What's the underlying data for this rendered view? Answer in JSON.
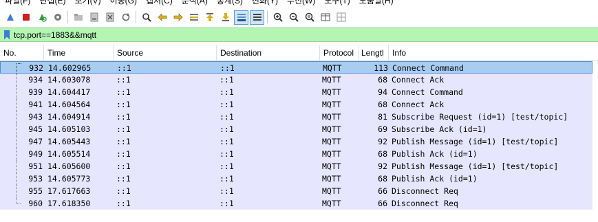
{
  "menu": [
    "파일(F)",
    "편집(E)",
    "보기(V)",
    "이동(G)",
    "캡처(C)",
    "분석(A)",
    "통계(S)",
    "전화(Y)",
    "무선(W)",
    "도구(T)",
    "도움말(H)"
  ],
  "toolbar": {
    "buttons": [
      {
        "icon": "shark-fin-start-icon"
      },
      {
        "icon": "stop-capture-icon"
      },
      {
        "icon": "restart-capture-icon"
      },
      {
        "icon": "capture-options-gear-icon"
      },
      {
        "icon": "open-file-icon"
      },
      {
        "icon": "save-file-icon"
      },
      {
        "icon": "close-file-icon"
      },
      {
        "icon": "reload-icon"
      },
      {
        "icon": "find-packet-icon"
      },
      {
        "icon": "go-back-icon"
      },
      {
        "icon": "go-forward-icon"
      },
      {
        "icon": "go-to-packet-icon"
      },
      {
        "icon": "go-first-icon"
      },
      {
        "icon": "go-last-icon"
      },
      {
        "icon": "auto-scroll-icon"
      },
      {
        "icon": "colorize-icon"
      },
      {
        "icon": "zoom-in-icon"
      },
      {
        "icon": "zoom-out-icon"
      },
      {
        "icon": "zoom-normal-icon"
      },
      {
        "icon": "resize-columns-icon"
      },
      {
        "icon": "expand-subtrees-icon"
      }
    ]
  },
  "filter": {
    "value": "tcp.port==1883&&mqtt"
  },
  "columns": {
    "no": "No.",
    "time": "Time",
    "source": "Source",
    "destination": "Destination",
    "protocol": "Protocol",
    "length": "Lengtl",
    "info": "Info"
  },
  "packets": [
    {
      "no": "932",
      "time": "14.602965",
      "source": "::1",
      "destination": "::1",
      "protocol": "MQTT",
      "length": "113",
      "info": "Connect Command"
    },
    {
      "no": "934",
      "time": "14.603078",
      "source": "::1",
      "destination": "::1",
      "protocol": "MQTT",
      "length": "68",
      "info": "Connect Ack"
    },
    {
      "no": "939",
      "time": "14.604417",
      "source": "::1",
      "destination": "::1",
      "protocol": "MQTT",
      "length": "94",
      "info": "Connect Command"
    },
    {
      "no": "941",
      "time": "14.604564",
      "source": "::1",
      "destination": "::1",
      "protocol": "MQTT",
      "length": "68",
      "info": "Connect Ack"
    },
    {
      "no": "943",
      "time": "14.604914",
      "source": "::1",
      "destination": "::1",
      "protocol": "MQTT",
      "length": "81",
      "info": "Subscribe Request (id=1) [test/topic]"
    },
    {
      "no": "945",
      "time": "14.605103",
      "source": "::1",
      "destination": "::1",
      "protocol": "MQTT",
      "length": "69",
      "info": "Subscribe Ack (id=1)"
    },
    {
      "no": "947",
      "time": "14.605443",
      "source": "::1",
      "destination": "::1",
      "protocol": "MQTT",
      "length": "92",
      "info": "Publish Message (id=1) [test/topic]"
    },
    {
      "no": "949",
      "time": "14.605514",
      "source": "::1",
      "destination": "::1",
      "protocol": "MQTT",
      "length": "68",
      "info": "Publish Ack (id=1)"
    },
    {
      "no": "951",
      "time": "14.605600",
      "source": "::1",
      "destination": "::1",
      "protocol": "MQTT",
      "length": "92",
      "info": "Publish Message (id=1) [test/topic]"
    },
    {
      "no": "953",
      "time": "14.605773",
      "source": "::1",
      "destination": "::1",
      "protocol": "MQTT",
      "length": "68",
      "info": "Publish Ack (id=1)"
    },
    {
      "no": "955",
      "time": "17.617663",
      "source": "::1",
      "destination": "::1",
      "protocol": "MQTT",
      "length": "66",
      "info": "Disconnect Req"
    },
    {
      "no": "960",
      "time": "17.618350",
      "source": "::1",
      "destination": "::1",
      "protocol": "MQTT",
      "length": "66",
      "info": "Disconnect Req"
    }
  ],
  "colors": {
    "row_bg": "#e7e6ff",
    "selected_bg": "#a8cdf0",
    "filter_bg": "#b4f5b4"
  }
}
